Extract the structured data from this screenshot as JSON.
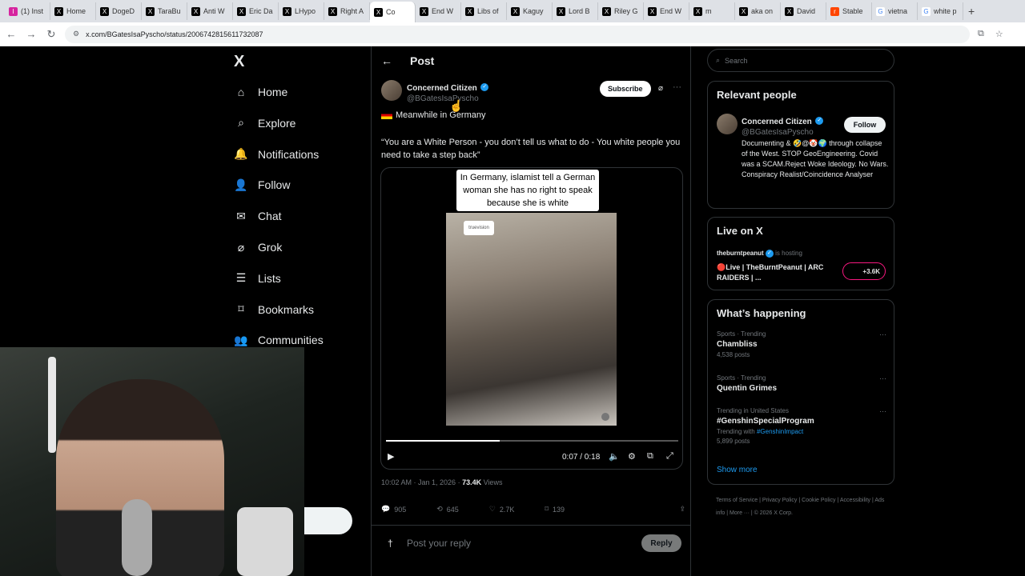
{
  "browser": {
    "tabs": [
      {
        "label": "(1) Inst",
        "icon": "instagram-icon",
        "active": false
      },
      {
        "label": "Home",
        "icon": "x-icon",
        "active": false
      },
      {
        "label": "DogeD",
        "icon": "x-icon",
        "active": false
      },
      {
        "label": "TaraBu",
        "icon": "x-icon",
        "active": false
      },
      {
        "label": "Anti W",
        "icon": "x-icon",
        "active": false
      },
      {
        "label": "Eric Da",
        "icon": "x-icon",
        "active": false
      },
      {
        "label": "LHypo",
        "icon": "x-icon",
        "active": false
      },
      {
        "label": "Right A",
        "icon": "x-icon",
        "active": false
      },
      {
        "label": "Co",
        "icon": "x-icon",
        "active": true
      },
      {
        "label": "End W",
        "icon": "x-icon",
        "active": false
      },
      {
        "label": "Libs of",
        "icon": "x-icon",
        "active": false
      },
      {
        "label": "Kaguy",
        "icon": "x-icon",
        "active": false
      },
      {
        "label": "Lord B",
        "icon": "x-icon",
        "active": false
      },
      {
        "label": "Riley G",
        "icon": "x-icon",
        "active": false
      },
      {
        "label": "End W",
        "icon": "x-icon",
        "active": false
      },
      {
        "label": "m",
        "icon": "x-icon",
        "active": false
      },
      {
        "label": "aka on",
        "icon": "x-icon",
        "active": false
      },
      {
        "label": "David",
        "icon": "x-icon",
        "active": false
      },
      {
        "label": "Stable",
        "icon": "reddit-icon",
        "active": false
      },
      {
        "label": "vietna",
        "icon": "google-icon",
        "active": false
      },
      {
        "label": "white p",
        "icon": "google-icon",
        "active": false
      }
    ],
    "new_tab": "+",
    "url": "x.com/BGatesIsaPyscho/status/2006742815611732087"
  },
  "sidebar": {
    "logo": "X",
    "items": [
      {
        "label": "Home",
        "icon": "home-icon"
      },
      {
        "label": "Explore",
        "icon": "search-icon"
      },
      {
        "label": "Notifications",
        "icon": "bell-icon"
      },
      {
        "label": "Follow",
        "icon": "person-add-icon"
      },
      {
        "label": "Chat",
        "icon": "mail-icon"
      },
      {
        "label": "Grok",
        "icon": "grok-icon"
      },
      {
        "label": "Lists",
        "icon": "list-icon"
      },
      {
        "label": "Bookmarks",
        "icon": "bookmark-icon"
      },
      {
        "label": "Communities",
        "icon": "communities-icon"
      }
    ]
  },
  "post": {
    "header": "Post",
    "author_name": "Concerned Citizen",
    "author_handle": "@BGatesIsaPyscho",
    "subscribe_label": "Subscribe",
    "line1": "Meanwhile in Germany",
    "line2": "“You are a White Person - you don’t tell us what to do - You white people you need to take a step back”",
    "video_caption": "In Germany, islamist  tell a German woman she has no right to speak because she is white",
    "video_logo": "truevision",
    "video_time": "0:07 / 0:18",
    "video_progress": 0.39,
    "timestamp": "10:02 AM · Jan 1, 2026 · ",
    "views_count": "73.4K",
    "views_label": " Views",
    "actions": {
      "replies": "905",
      "reposts": "645",
      "likes": "2.7K",
      "bookmarks": "139"
    },
    "reply_placeholder": "Post your reply",
    "reply_button": "Reply"
  },
  "right": {
    "search_placeholder": "Search",
    "relevant_title": "Relevant people",
    "person_name": "Concerned Citizen",
    "person_handle": "@BGatesIsaPyscho",
    "follow_label": "Follow",
    "bio": "Documenting & 🤣@🤡🌍 through collapse of the West. STOP GeoEngineering. Covid was a SCAM.Reject Woke Ideology. No Wars. Conspiracy Realist/Coincidence Analyser",
    "live_title": "Live on X",
    "live_host": "theburntpeanut",
    "live_status": "is hosting",
    "live_title_text": "🔴Live | TheBurntPeanut | ARC RAIDERS | ...",
    "live_count": "+3.6K",
    "happening_title": "What’s happening",
    "trends": [
      {
        "sub": "Sports · Trending",
        "name": "Chambliss",
        "count": "4,538 posts"
      },
      {
        "sub": "Sports · Trending",
        "name": "Quentin Grimes",
        "count": ""
      },
      {
        "sub": "Trending in United States",
        "name": "#GenshinSpecialProgram",
        "count": "5,899 posts",
        "with_label": "Trending with ",
        "with_tag": "#GenshinImpact"
      }
    ],
    "show_more": "Show more",
    "footer": [
      "Terms of Service",
      "Privacy Policy",
      "Cookie Policy",
      "Accessibility",
      "Ads info",
      "More ···",
      "© 2026 X Corp."
    ]
  },
  "colors": {
    "accent": "#1d9bf0",
    "background": "#000000",
    "border": "#2f3336"
  }
}
